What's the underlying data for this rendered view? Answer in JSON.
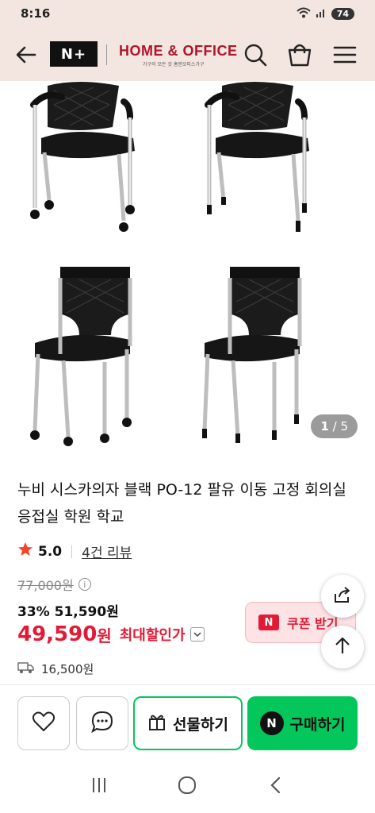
{
  "status_bar": {
    "time": "8:16",
    "battery": "74"
  },
  "header": {
    "logo": "N+",
    "brand": "HOME & OFFICE",
    "brand_sub": "가구의 모든 것 홈앤오피스가구"
  },
  "gallery": {
    "current": "1",
    "total": "/ 5"
  },
  "product": {
    "title": "누비 시스카의자 블랙 PO-12 팔유 이동 고정 회의실 응접실 학원 학교",
    "rating": "5.0",
    "reviews": "4건 리뷰",
    "original_price": "77,000원",
    "discount_line": "33% 51,590원",
    "final_price": "49,590",
    "final_unit": "원",
    "max_discount_label": "최대할인가",
    "coupon_label": "쿠폰 받기",
    "shipping": "16,500원"
  },
  "actions": {
    "gift": "선물하기",
    "buy": "구매하기"
  },
  "colors": {
    "accent_red": "#e21a35",
    "naver_green": "#03c75a",
    "header_bg": "#f3e6e0"
  }
}
